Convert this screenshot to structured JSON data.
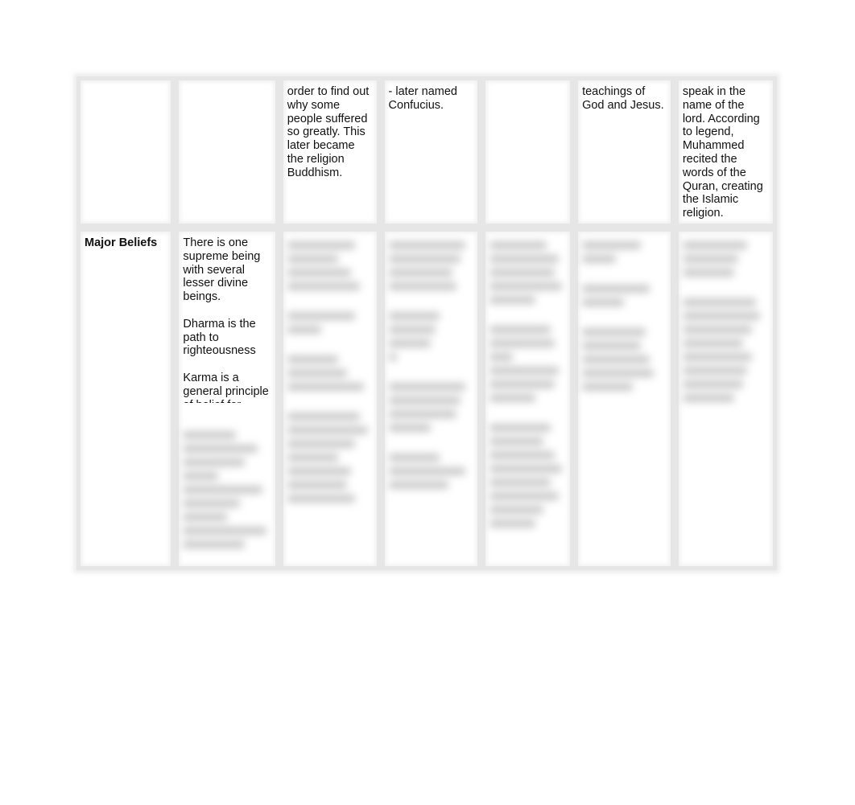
{
  "document": {
    "table": {
      "rows": [
        {
          "cells": [
            {
              "text": ""
            },
            {
              "text": ""
            },
            {
              "text": "order to find out why some people suffered so greatly. This later became the religion Buddhism."
            },
            {
              "text": "- later named Confucius."
            },
            {
              "text": ""
            },
            {
              "text": "teachings of God and Jesus."
            },
            {
              "text": "speak in the name of the lord. According to legend, Muhammed recited the words of the Quran, creating the Islamic religion."
            }
          ]
        },
        {
          "row_label": "Major Beliefs",
          "cells": [
            {
              "paragraphs": [
                "There is one supreme being with several lesser divine beings.",
                "Dharma is the path to righteousness",
                "Karma is a general principle of belief for"
              ],
              "continuation": "[blurred text]"
            },
            {
              "text": "[blurred text]"
            },
            {
              "text": "[blurred text]"
            },
            {
              "text": "[blurred text]"
            },
            {
              "text": "[blurred text]"
            },
            {
              "text": "[blurred text]"
            }
          ]
        }
      ]
    }
  }
}
